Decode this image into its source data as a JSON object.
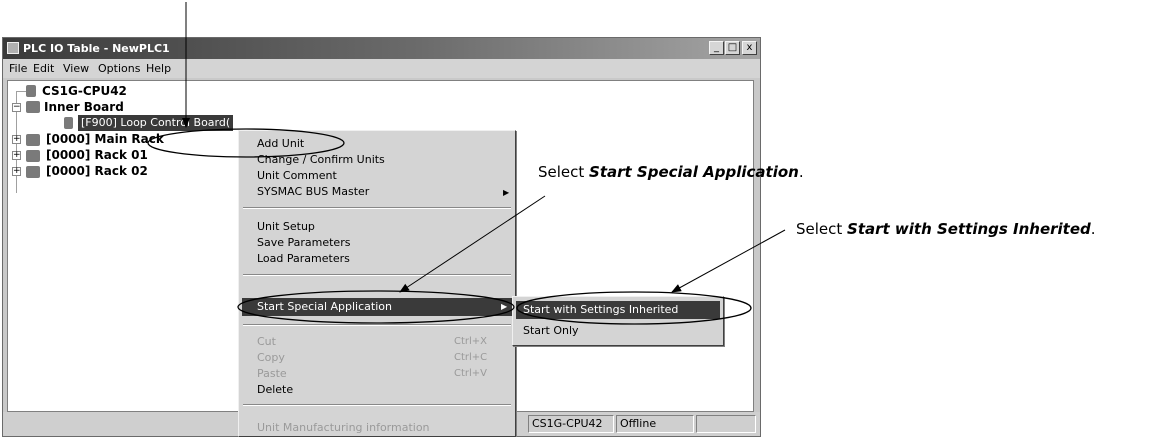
{
  "window": {
    "title": "PLC IO Table - NewPLC1",
    "buttons": {
      "minimize": "_",
      "maximize": "□",
      "close": "x"
    }
  },
  "menubar": [
    "File",
    "Edit",
    "View",
    "Options",
    "Help"
  ],
  "tree": {
    "cpu": "CS1G-CPU42",
    "inner_board": "Inner Board",
    "inner_board_item": "[F900] Loop Control Board(",
    "main_rack": "[0000] Main Rack",
    "rack01": "[0000] Rack 01",
    "rack02": "[0000] Rack 02"
  },
  "context_menu": {
    "items": [
      "Add Unit",
      "Change / Confirm Units",
      "Unit Comment",
      "SYSMAC BUS Master",
      "Unit Setup",
      "Save Parameters",
      "Load Parameters",
      "Start Special Application",
      "Cut",
      "Copy",
      "Paste",
      "Delete",
      "Unit Manufacturing information"
    ],
    "shortcuts": {
      "cut": "Ctrl+X",
      "copy": "Ctrl+C",
      "paste": "Ctrl+V"
    }
  },
  "submenu": {
    "items": [
      "Start with Settings Inherited",
      "Start Only"
    ]
  },
  "statusbar": {
    "model": "CS1G-CPU42",
    "status": "Offline"
  },
  "callouts": {
    "c1_prefix": "Select ",
    "c1_bold": "Start Special Application",
    "c1_suffix": ".",
    "c2_prefix": "Select ",
    "c2_bold": "Start with Settings Inherited",
    "c2_suffix": "."
  }
}
